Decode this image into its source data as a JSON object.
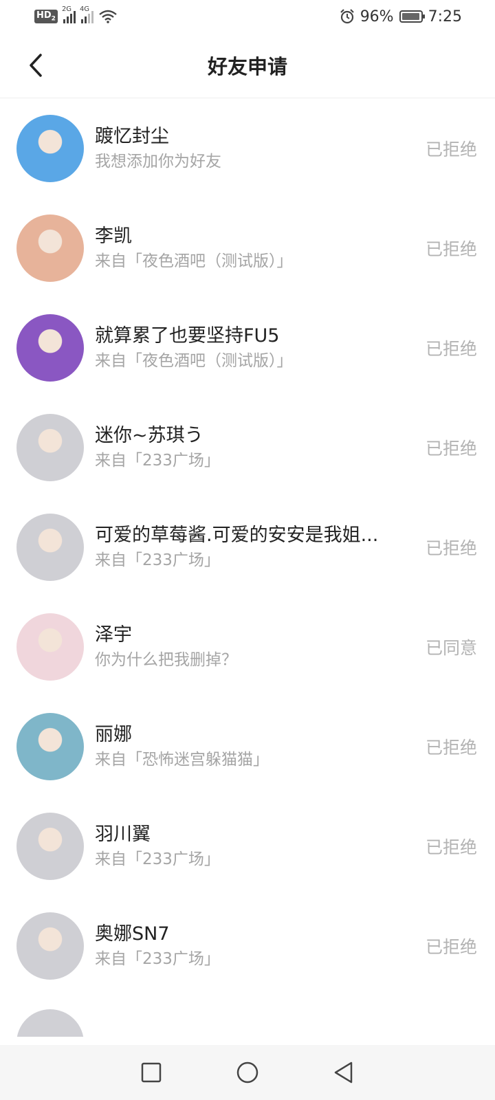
{
  "status_bar": {
    "hd": "HD",
    "hd_sub": "2",
    "sim1": "2G",
    "sim2": "4G",
    "battery": "96%",
    "time": "7:25"
  },
  "header": {
    "title": "好友申请"
  },
  "requests": [
    {
      "name": "踱忆封尘",
      "message": "我想添加你为好友",
      "status": "已拒绝",
      "avatar_color": "#5aa7e6"
    },
    {
      "name": "李凯",
      "message": "来自「夜色酒吧（测试版）」",
      "status": "已拒绝",
      "avatar_color": "#e7b39a"
    },
    {
      "name": "就算累了也要坚持FU5",
      "message": "来自「夜色酒吧（测试版）」",
      "status": "已拒绝",
      "avatar_color": "#8a57c2"
    },
    {
      "name": "迷你~苏琪う",
      "message": "来自「233广场」",
      "status": "已拒绝",
      "avatar_color": "#cfcfd4"
    },
    {
      "name": "可爱的草莓酱.可爱的安安是我姐...",
      "message": "来自「233广场」",
      "status": "已拒绝",
      "avatar_color": "#cfcfd4"
    },
    {
      "name": "泽宇",
      "message": "你为什么把我删掉？",
      "status": "已同意",
      "avatar_color": "#f0d6dc"
    },
    {
      "name": "丽娜",
      "message": "来自「恐怖迷宫躲猫猫」",
      "status": "已拒绝",
      "avatar_color": "#7fb6c9"
    },
    {
      "name": "羽川翼",
      "message": "来自「233广场」",
      "status": "已拒绝",
      "avatar_color": "#cfcfd4"
    },
    {
      "name": "奥娜SN7",
      "message": "来自「233广场」",
      "status": "已拒绝",
      "avatar_color": "#cfcfd4"
    }
  ],
  "partial_item": {
    "name": "",
    "avatar_color": "#d0d0d5"
  }
}
